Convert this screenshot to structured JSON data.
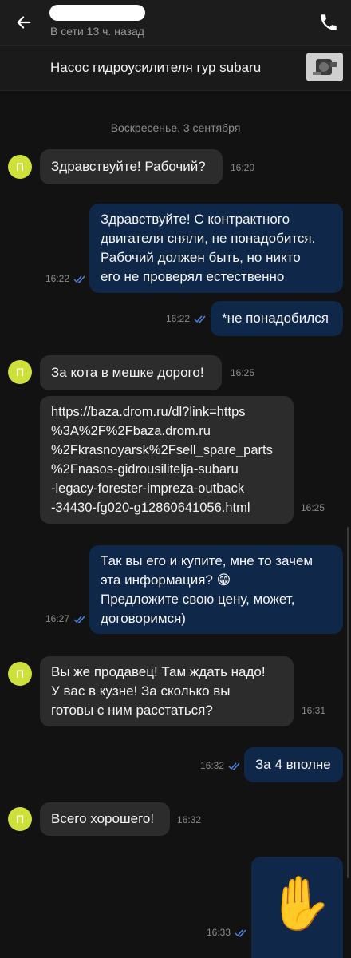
{
  "header": {
    "status": "В сети 13 ч. назад"
  },
  "listing": {
    "title": "Насос гидроусилителя гур subaru"
  },
  "chat": {
    "date_separator": "Воскресенье, 3 сентября",
    "avatar_letter": "П",
    "messages": [
      {
        "text": "Здравствуйте!  Рабочий?",
        "time": "16:20"
      },
      {
        "text": "Здравствуйте! С контрактного\nдвигателя сняли, не понадобится.\nРабочий должен быть, но никто\nего не проверял естественно",
        "time": "16:22"
      },
      {
        "text": "*не понадобился",
        "time": "16:22"
      },
      {
        "text": "За кота в мешке дорого!",
        "time": "16:25"
      },
      {
        "text": "https://baza.drom.ru/dl?link=https\n%3A%2F%2Fbaza.drom.ru\n%2Fkrasnoyarsk%2Fsell_spare_parts\n%2Fnasos-gidrousilitelja-subaru\n-legacy-forester-impreza-outback\n-34430-fg020-g12860641056.html",
        "time": "16:25"
      },
      {
        "text": "Так вы его и купите, мне то зачем\nэта информация? 😁\nПредложите свою цену, может,\nдоговоримся)",
        "time": "16:27"
      },
      {
        "text": "Вы же продавец! Там ждать надо!\nУ вас в кузне! За сколько вы\nготовы с ним расстаться?",
        "time": "16:31"
      },
      {
        "text": "За 4 вполне",
        "time": "16:32"
      },
      {
        "text": "Всего хорошего!",
        "time": "16:32"
      },
      {
        "emoji": "✋",
        "time": "16:33"
      }
    ]
  },
  "colors": {
    "background": "#121212",
    "incoming_bubble": "#2c2c2c",
    "outgoing_bubble": "#0f2849",
    "avatar": "#cde13a",
    "read_ticks": "#4a86e8"
  }
}
